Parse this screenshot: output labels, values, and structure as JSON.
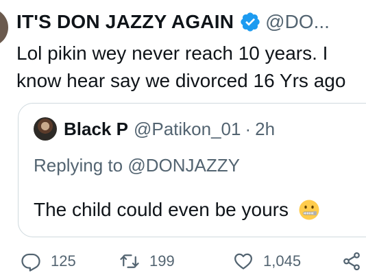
{
  "tweet": {
    "display_name": "IT'S DON JAZZY AGAIN",
    "handle": "@DO...",
    "text_line_1": "Lol pikin wey never reach 10 years. I",
    "text_line_2": "know hear say we divorced 16 Yrs ago",
    "verified": true,
    "verified_color": "#1d9bf0"
  },
  "quoted_tweet": {
    "display_name": "Black P",
    "handle": "@Patikon_01",
    "separator": "·",
    "time": "2h",
    "replying_prefix": "Replying to",
    "replying_to": "@DONJAZZY",
    "text": "The child could even be yours",
    "emoji": "zipper-mouth-face-icon"
  },
  "actions": {
    "reply_count": "125",
    "retweet_count": "199",
    "like_count": "1,045",
    "icons": [
      "reply-icon",
      "retweet-icon",
      "like-icon",
      "share-icon"
    ]
  },
  "colors": {
    "text": "#0f1419",
    "secondary": "#536471",
    "border": "#cfd9de"
  }
}
